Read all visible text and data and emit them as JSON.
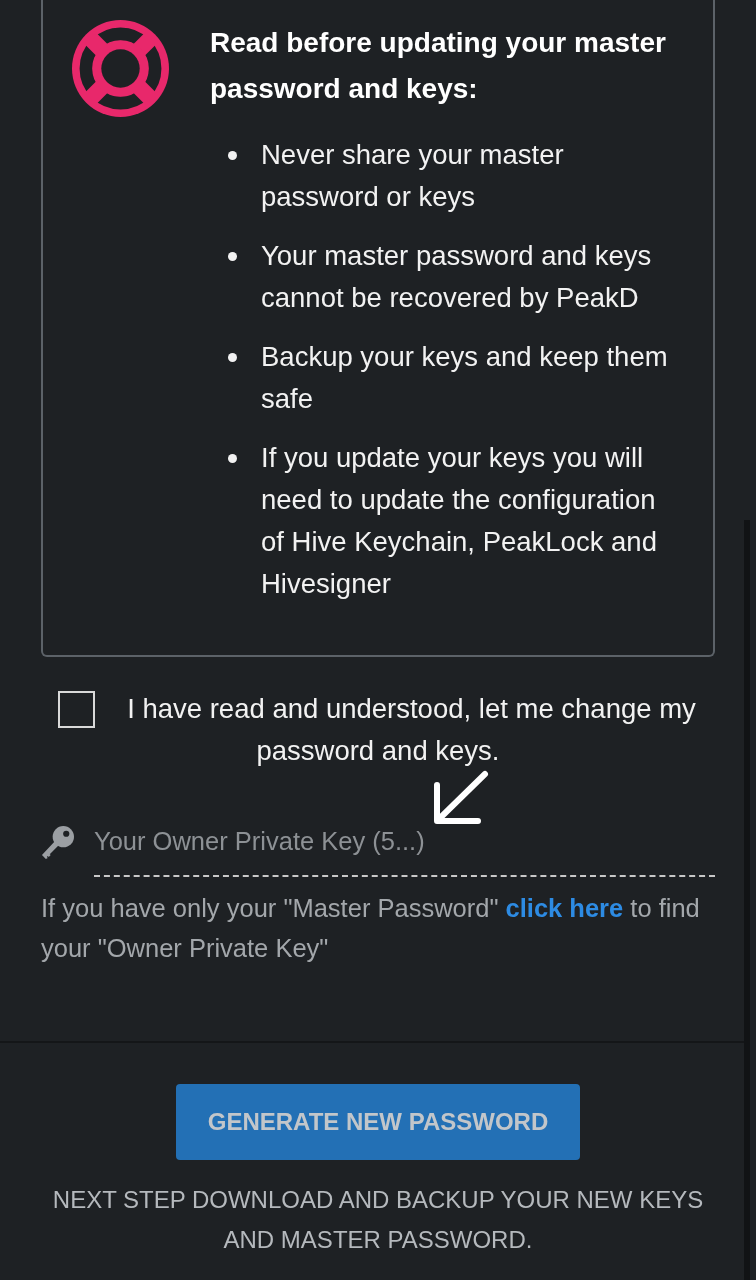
{
  "notice": {
    "title": "Read before updating your master password and keys:",
    "items": [
      "Never share your master password or keys",
      "Your master password and keys cannot be recovered by PeakD",
      "Backup your keys and keep them safe",
      "If you update your keys you will need to update the configuration of Hive Keychain, PeakLock and Hivesigner"
    ]
  },
  "confirm": {
    "label": "I have read and understood, let me change my password and keys.",
    "checked": false
  },
  "owner_key_field": {
    "placeholder": "Your Owner Private Key (5...)"
  },
  "help": {
    "before": "If you have only your \"Master Password\" ",
    "link": "click here",
    "after": " to find your \"Owner Private Key\""
  },
  "generate_button": {
    "label": "GENERATE NEW PASSWORD",
    "disabled": true
  },
  "next_step": "NEXT STEP DOWNLOAD AND BACKUP YOUR NEW KEYS AND MASTER PASSWORD."
}
